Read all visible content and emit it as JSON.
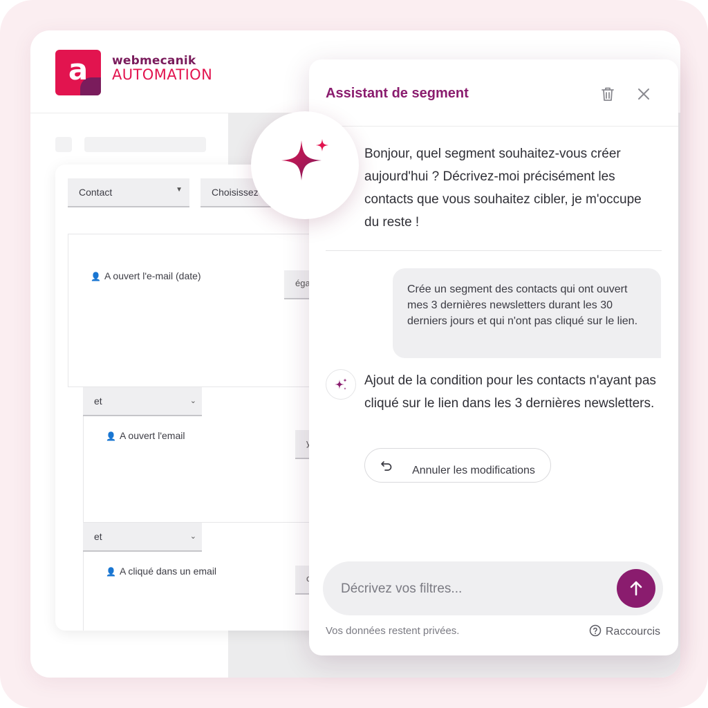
{
  "brand": {
    "name_top": "webmecanik",
    "name_bottom": "AUTOMATION",
    "logo_glyph": "a",
    "colors": {
      "primary": "#e2144f",
      "secondary": "#7a1c5c"
    }
  },
  "segment_builder": {
    "object_select": "Contact",
    "field_select": "Choisissez-",
    "conditions": [
      {
        "label": "A ouvert l'e-mail (date)",
        "edge": "éga"
      },
      {
        "connector": "et",
        "label": "A ouvert l'email",
        "edge": "y"
      },
      {
        "connector": "et",
        "label": "A cliqué dans un email",
        "edge": "c"
      }
    ]
  },
  "assistant": {
    "title": "Assistant de segment",
    "accent_color": "#8a1c6e",
    "icons": {
      "delete": "trash-icon",
      "close": "close-icon",
      "hero": "sparkle-icon",
      "send": "arrow-up-icon"
    },
    "intro_message": "Bonjour, quel segment souhaitez-vous créer aujourd'hui ? Décrivez-moi précisément les contacts que vous souhaitez cibler, je m'occupe du reste !",
    "user_message": "Crée un segment des contacts qui ont ouvert mes 3 dernières newsletters durant les 30 derniers jours et qui n'ont pas cliqué sur le lien.",
    "bot_message": "Ajout de la condition pour les contacts n'ayant pas cliqué sur le lien dans les 3 dernières newsletters.",
    "undo_label": "Annuler les modifications",
    "input_placeholder": "Décrivez vos filtres...",
    "privacy_note": "Vos données restent privées.",
    "shortcuts_label": "Raccourcis"
  }
}
